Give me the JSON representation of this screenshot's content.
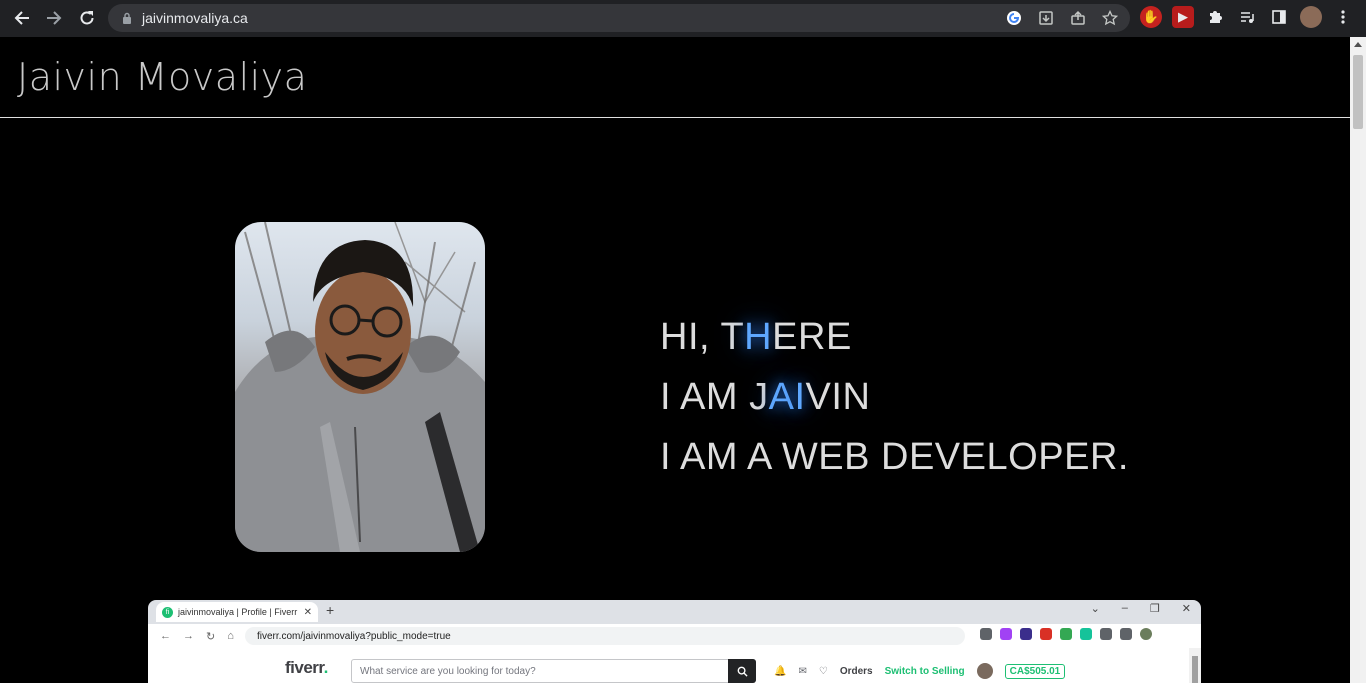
{
  "browser": {
    "url": "jaivinmovaliya.ca",
    "back_icon": "arrow-left-icon",
    "forward_icon": "arrow-right-icon",
    "reload_icon": "reload-icon"
  },
  "site": {
    "title": "Jaivin Movaliya"
  },
  "hero": {
    "line1": "HI, THERE",
    "line2": "I AM JAIVIN",
    "line3": "I AM A WEB DEVELOPER."
  },
  "embed": {
    "tab_title": "jaivinmovaliya | Profile | Fiverr",
    "tab_favicon": "fi",
    "address": "fiverr.com/jaivinmovaliya?public_mode=true",
    "logo": "fiverr",
    "logo_dot": ".",
    "search_placeholder": "What service are you looking for today?",
    "orders": "Orders",
    "switch": "Switch to Selling",
    "balance": "CA$505.01"
  },
  "colors": {
    "accent_glow": "#5fa8ff",
    "fiverr_green": "#1dbf73"
  }
}
